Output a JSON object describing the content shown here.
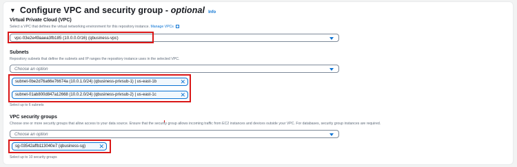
{
  "section": {
    "title_main": "Configure VPC and security group - ",
    "title_optional": "optional",
    "info": "Info"
  },
  "vpc": {
    "label": "Virtual Private Cloud (VPC)",
    "description": "Select a VPC that defines the virtual networking environment for this repository instance.",
    "manage_link": "Manage VPCs",
    "selected": "vpc-03e2e49aaea3fb185 (10.0.0.0/16) (qbusiness-vpc)"
  },
  "subnets": {
    "label": "Subnets",
    "description": "Repository subnets that define the subnets and IP ranges the repository instance uses in the selected VPC.",
    "placeholder": "Choose an option",
    "tokens": [
      "subnet-0be2d76a66e76674a (10.0.1.0/24) (qbusiness-privsub-1) | us-east-1b",
      "subnet-01ab800d847a12668 (10.0.2.0/24) (qbusiness-privsub-2) | us-east-1c"
    ],
    "hint": "Select up to 6 subnets"
  },
  "security_groups": {
    "label": "VPC security groups",
    "description": "Choose one or more security groups that allow access to your data source. Ensure that the security group allows incoming traffic from EC2 instances and devices outside your VPC. For databases, security group instances are required.",
    "placeholder": "Choose an option",
    "tokens": [
      "sg-03542affb113040e7 (qbusiness-sg)"
    ],
    "hint": "Select up to 10 security groups"
  },
  "colors": {
    "accent": "#0972d3",
    "highlight": "#d91515"
  }
}
